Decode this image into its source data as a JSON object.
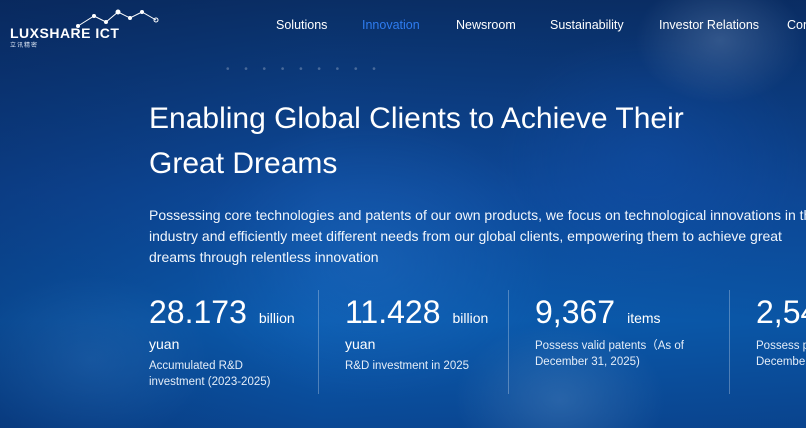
{
  "header": {
    "logo_text": "LUXSHARE ICT",
    "logo_sub": "立讯精密",
    "nav": [
      {
        "label": "Solutions",
        "active": false
      },
      {
        "label": "Innovation",
        "active": true
      },
      {
        "label": "Newsroom",
        "active": false
      },
      {
        "label": "Sustainability",
        "active": false
      },
      {
        "label": "Investor Relations",
        "active": false
      },
      {
        "label": "Con",
        "active": false
      }
    ],
    "colors": {
      "active_nav": "#2e7cf0"
    }
  },
  "hero": {
    "title_line1": "Enabling Global Clients to Achieve Their",
    "title_line2": "Great Dreams",
    "desc_line1": "Possessing core technologies and patents of our own products, we focus on technological innovations in the",
    "desc_line2": "industry and efficiently meet different needs from our global clients, empowering them to achieve great",
    "desc_line3": "dreams through relentless innovation"
  },
  "stats": [
    {
      "number": "28.173",
      "unit": "billion",
      "unit2": "yuan",
      "label_line1": "Accumulated R&D",
      "label_line2": "investment (2023-2025)"
    },
    {
      "number": "11.428",
      "unit": "billion",
      "unit2": "yuan",
      "label_line1": "R&D investment in 2025",
      "label_line2": ""
    },
    {
      "number": "9,367",
      "unit": "items",
      "unit2": "",
      "label_line1": "Possess valid patents（As of",
      "label_line2": "December 31, 2025)"
    },
    {
      "number": "2,54",
      "unit": "",
      "unit2": "",
      "label_line1": "Possess p",
      "label_line2": "December"
    }
  ]
}
